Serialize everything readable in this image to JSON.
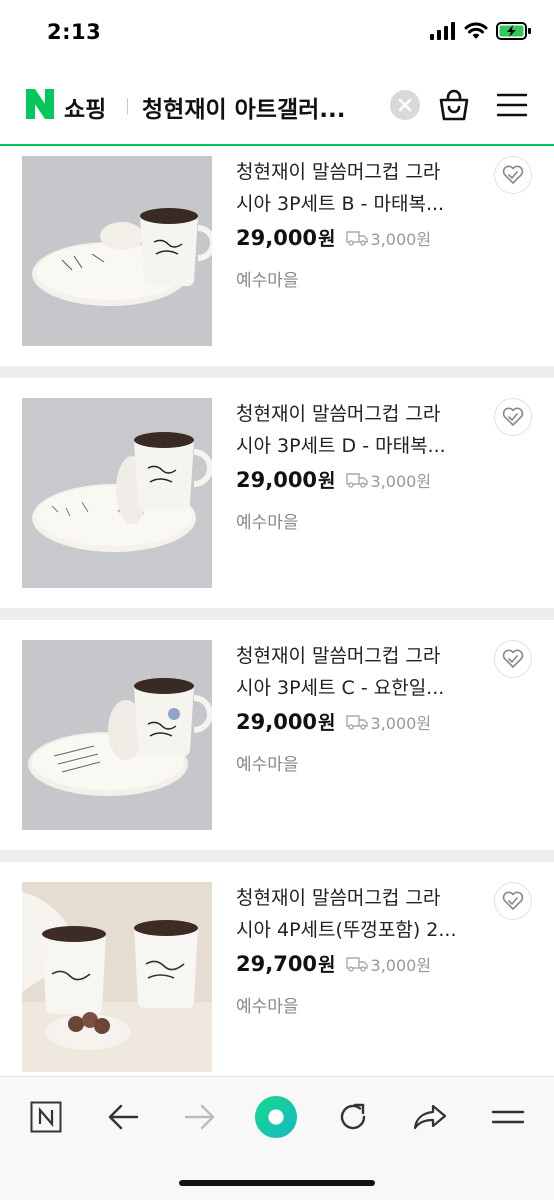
{
  "status_bar": {
    "time": "2:13"
  },
  "header": {
    "logo_letter": "N",
    "section_label": "쇼핑",
    "title": "청현재이 아트갤러...",
    "brand_color": "#03c75a"
  },
  "products": [
    {
      "name_line1": "청현재이 말씀머그컵 그라",
      "name_line2": "시아 3P세트 B - 마태복...",
      "price": "29,000",
      "currency": "원",
      "shipping": "3,000원",
      "store": "예수마을"
    },
    {
      "name_line1": "청현재이 말씀머그컵 그라",
      "name_line2": "시아 3P세트 D - 마태복...",
      "price": "29,000",
      "currency": "원",
      "shipping": "3,000원",
      "store": "예수마을"
    },
    {
      "name_line1": "청현재이 말씀머그컵 그라",
      "name_line2": "시아 3P세트 C - 요한일...",
      "price": "29,000",
      "currency": "원",
      "shipping": "3,000원",
      "store": "예수마을"
    },
    {
      "name_line1": "청현재이 말씀머그컵 그라",
      "name_line2": "시아 4P세트(뚜껑포함) 2...",
      "price": "29,700",
      "currency": "원",
      "shipping": "3,000원",
      "store": "예수마을"
    }
  ],
  "icons": {
    "signal": "signal-icon",
    "wifi": "wifi-icon",
    "battery": "battery-charging-icon",
    "clear": "clear-icon",
    "cart": "shopping-bag-icon",
    "menu": "hamburger-menu-icon",
    "favorite": "heart-icon",
    "shipping": "delivery-truck-icon",
    "nav": [
      "naver-home-icon",
      "back-arrow-icon",
      "forward-arrow-icon",
      "green-dot-icon",
      "refresh-icon",
      "share-icon",
      "more-menu-icon"
    ]
  }
}
